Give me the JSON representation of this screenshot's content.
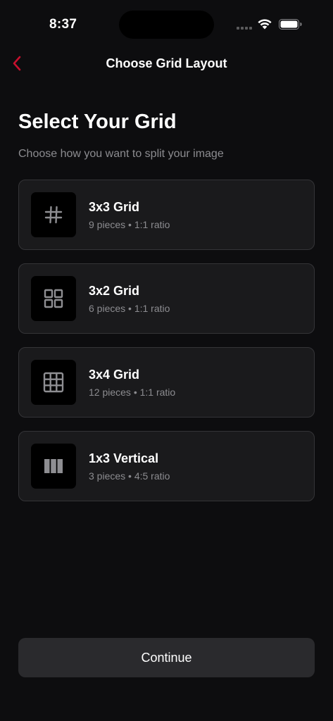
{
  "status_bar": {
    "time": "8:37",
    "icons": [
      "cellular-signal-icon",
      "wifi-icon",
      "battery-icon"
    ]
  },
  "nav": {
    "back_icon": "chevron-left-icon",
    "title": "Choose Grid Layout"
  },
  "heading": "Select Your Grid",
  "subtitle": "Choose how you want to split your image",
  "options": [
    {
      "icon": "hash-grid-icon",
      "title": "3x3 Grid",
      "meta": "9 pieces • 1:1 ratio"
    },
    {
      "icon": "four-squares-grid-icon",
      "title": "3x2 Grid",
      "meta": "6 pieces • 1:1 ratio"
    },
    {
      "icon": "table-grid-icon",
      "title": "3x4 Grid",
      "meta": "12 pieces • 1:1 ratio"
    },
    {
      "icon": "vertical-columns-icon",
      "title": "1x3 Vertical",
      "meta": "3 pieces • 4:5 ratio"
    }
  ],
  "continue_label": "Continue",
  "colors": {
    "background": "#0d0d0f",
    "card": "#1a1a1c",
    "card_border": "#343437",
    "accent": "#c8102e",
    "muted_text": "#8c8c90",
    "button": "#2a2a2d"
  }
}
